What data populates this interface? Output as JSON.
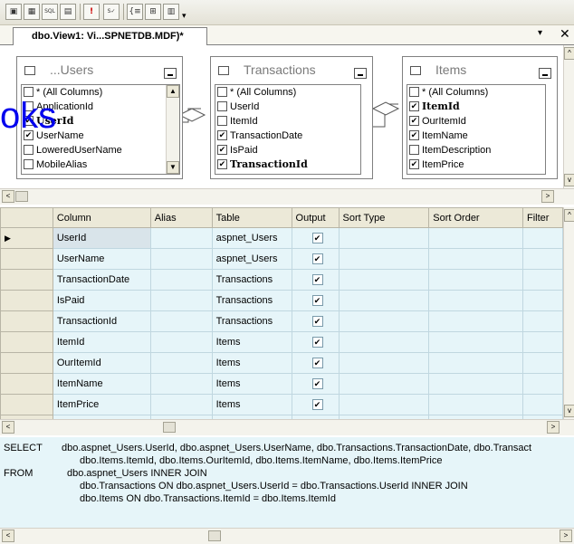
{
  "toolbar": {
    "buttons": [
      "diagram-pane-icon",
      "criteria-pane-icon",
      "sql-pane-icon",
      "results-pane-icon",
      "execute-icon",
      "verify-sql-icon",
      "group-by-icon",
      "add-table-icon",
      "add-derived-table-icon"
    ],
    "sql_label": "SQL",
    "execute_label": "!"
  },
  "tab": {
    "title": "dbo.View1: Vi...SPNETDB.MDF)*",
    "menu_glyph": "▾",
    "close_glyph": "✕"
  },
  "watermark": "oks",
  "tables": [
    {
      "title": "aspnet_Users",
      "visible_title": "...Users",
      "columns": [
        {
          "name": "* (All Columns)",
          "checked": false,
          "bold": false
        },
        {
          "name": "ApplicationId",
          "checked": false,
          "bold": false
        },
        {
          "name": "UserId",
          "checked": true,
          "bold": true
        },
        {
          "name": "UserName",
          "checked": true,
          "bold": false
        },
        {
          "name": "LoweredUserName",
          "checked": false,
          "bold": false
        },
        {
          "name": "MobileAlias",
          "checked": false,
          "bold": false
        }
      ]
    },
    {
      "title": "Transactions",
      "columns": [
        {
          "name": "* (All Columns)",
          "checked": false,
          "bold": false
        },
        {
          "name": "UserId",
          "checked": false,
          "bold": false
        },
        {
          "name": "ItemId",
          "checked": false,
          "bold": false
        },
        {
          "name": "TransactionDate",
          "checked": true,
          "bold": false
        },
        {
          "name": "IsPaid",
          "checked": true,
          "bold": false
        },
        {
          "name": "TransactionId",
          "checked": true,
          "bold": true
        }
      ]
    },
    {
      "title": "Items",
      "columns": [
        {
          "name": "* (All Columns)",
          "checked": false,
          "bold": false
        },
        {
          "name": "ItemId",
          "checked": true,
          "bold": true
        },
        {
          "name": "OurItemId",
          "checked": true,
          "bold": false
        },
        {
          "name": "ItemName",
          "checked": true,
          "bold": false
        },
        {
          "name": "ItemDescription",
          "checked": false,
          "bold": false
        },
        {
          "name": "ItemPrice",
          "checked": true,
          "bold": false
        }
      ]
    }
  ],
  "grid": {
    "headers": [
      "Column",
      "Alias",
      "Table",
      "Output",
      "Sort Type",
      "Sort Order",
      "Filter"
    ],
    "rows": [
      {
        "column": "UserId",
        "alias": "",
        "table": "aspnet_Users",
        "output": true
      },
      {
        "column": "UserName",
        "alias": "",
        "table": "aspnet_Users",
        "output": true
      },
      {
        "column": "TransactionDate",
        "alias": "",
        "table": "Transactions",
        "output": true
      },
      {
        "column": "IsPaid",
        "alias": "",
        "table": "Transactions",
        "output": true
      },
      {
        "column": "TransactionId",
        "alias": "",
        "table": "Transactions",
        "output": true
      },
      {
        "column": "ItemId",
        "alias": "",
        "table": "Items",
        "output": true
      },
      {
        "column": "OurItemId",
        "alias": "",
        "table": "Items",
        "output": true
      },
      {
        "column": "ItemName",
        "alias": "",
        "table": "Items",
        "output": true
      },
      {
        "column": "ItemPrice",
        "alias": "",
        "table": "Items",
        "output": true
      }
    ]
  },
  "sql": {
    "select_kw": "SELECT",
    "select_line1": "dbo.aspnet_Users.UserId, dbo.aspnet_Users.UserName, dbo.Transactions.TransactionDate, dbo.Transact",
    "select_line2": "dbo.Items.ItemId, dbo.Items.OurItemId, dbo.Items.ItemName, dbo.Items.ItemPrice",
    "from_kw": "FROM",
    "from_line1": "dbo.aspnet_Users INNER JOIN",
    "from_line2": "dbo.Transactions ON dbo.aspnet_Users.UserId = dbo.Transactions.UserId INNER JOIN",
    "from_line3": "dbo.Items ON dbo.Transactions.ItemId = dbo.Items.ItemId"
  },
  "check_glyph": "✔",
  "arrows": {
    "left": "<",
    "right": ">",
    "up": "^",
    "down": "v"
  }
}
